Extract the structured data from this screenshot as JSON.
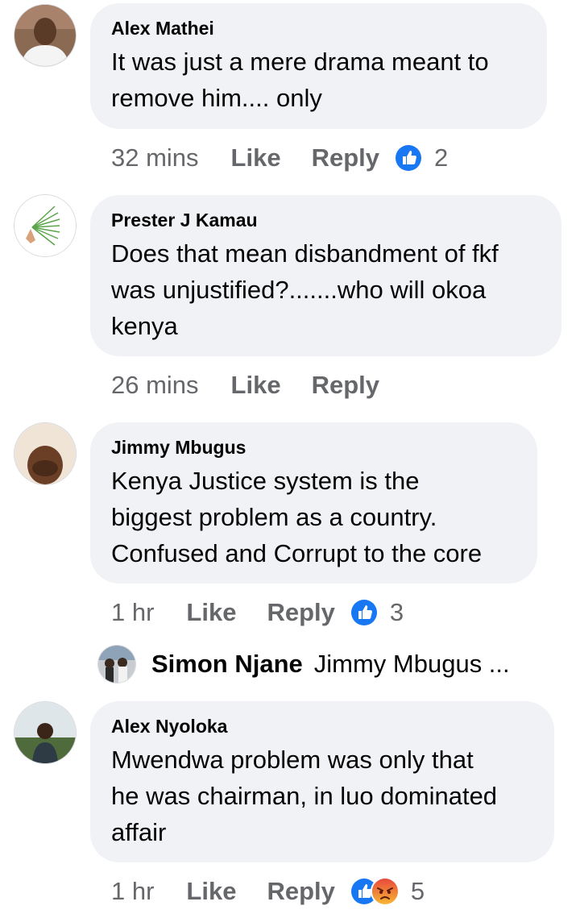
{
  "colors": {
    "bubble": "#f0f2f5",
    "meta_text": "#65676b",
    "like_blue": "#1877f2",
    "angry_orange": "#f05a1c"
  },
  "comments": [
    {
      "author": "Alex Mathei",
      "text": [
        "It was just a mere drama meant to",
        "remove him.... only"
      ],
      "time": "32 mins",
      "like": "Like",
      "reply": "Reply",
      "reactions": [
        "like-icon"
      ],
      "reaction_count": "2"
    },
    {
      "author": "Prester J Kamau",
      "text": [
        "Does that mean disbandment of fkf",
        "was unjustified?.......who will okoa",
        "kenya"
      ],
      "time": "26 mins",
      "like": "Like",
      "reply": "Reply"
    },
    {
      "author": "Jimmy Mbugus",
      "text": [
        "Kenya Justice system is the",
        "biggest problem as a country.",
        "Confused and Corrupt to the core"
      ],
      "time": "1 hr",
      "like": "Like",
      "reply": "Reply",
      "reactions": [
        "like-icon"
      ],
      "reaction_count": "3",
      "reply_preview": {
        "author": "Simon Njane",
        "snippet": "Jimmy Mbugus ..."
      }
    },
    {
      "author": "Alex Nyoloka",
      "text": [
        "Mwendwa problem was only that",
        "he was chairman, in luo dominated",
        "affair"
      ],
      "time": "1 hr",
      "like": "Like",
      "reply": "Reply",
      "reactions": [
        "like-icon",
        "angry-icon"
      ],
      "reaction_count": "5"
    }
  ]
}
